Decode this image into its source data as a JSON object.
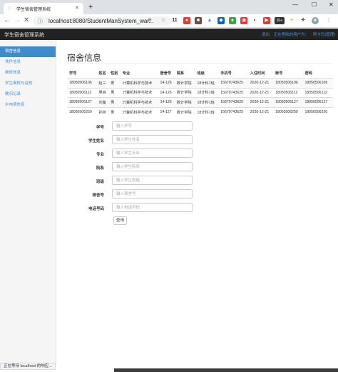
{
  "browser": {
    "tab_title": "学生宿舍管理系统",
    "url": "localhost:8080/StudentManSystem_war...",
    "extensions": [
      "11",
      "30+"
    ]
  },
  "app": {
    "brand": "学生宿舍管理系统",
    "header_links": [
      "退出",
      "正在登陆的用户为：",
      "阿卡玛(管理)"
    ]
  },
  "sidebar": {
    "items": [
      {
        "label": "宿舍信息",
        "active": true
      },
      {
        "label": "快件信息"
      },
      {
        "label": "维修信息"
      },
      {
        "label": "学生离校与返校"
      },
      {
        "label": "晚归记录"
      },
      {
        "label": "水电费信息"
      }
    ]
  },
  "main": {
    "title": "宿舍信息",
    "columns": [
      "学号",
      "姓名",
      "性别",
      "专业",
      "宿舍号",
      "院系",
      "班级",
      "手机号",
      "入住时间",
      "账号",
      "密码"
    ],
    "rows": [
      [
        "18050506106",
        "赵三",
        "男",
        "计算机科学与技术",
        "14-126",
        "数计学院",
        "18计科1班",
        "15679743625",
        "2020-12-21",
        "18050506106",
        "18050506106"
      ],
      [
        "18050506112",
        "吴四",
        "男",
        "计算机科学与技术",
        "14-126",
        "数计学院",
        "18计科1班",
        "15679743625",
        "2020-12-21",
        "18050506112",
        "18050506112"
      ],
      [
        "18050506127",
        "刘备",
        "男",
        "计算机科学与技术",
        "14-126",
        "数计学院",
        "18计科1班",
        "15679743625",
        "2020-12-21",
        "18050506127",
        "18050506127"
      ],
      [
        "18050506250",
        "孙权",
        "男",
        "计算机科学与技术",
        "14-127",
        "数计学院",
        "18计科1班",
        "15679743625",
        "2020-12-21",
        "18050506250",
        "18050506250"
      ]
    ],
    "form": [
      {
        "label": "学号",
        "placeholder": "输入学号"
      },
      {
        "label": "学生姓名",
        "placeholder": "输入学生姓名"
      },
      {
        "label": "专业",
        "placeholder": "输入学生专业"
      },
      {
        "label": "院系",
        "placeholder": "输入学生院系"
      },
      {
        "label": "班级",
        "placeholder": "输入学生班级"
      },
      {
        "label": "宿舍号",
        "placeholder": "输入宿舍号"
      },
      {
        "label": "电话号码",
        "placeholder": "输入电话号码"
      }
    ],
    "query_label": "查询"
  },
  "status_text": "正在等待 localhost 的响应..."
}
